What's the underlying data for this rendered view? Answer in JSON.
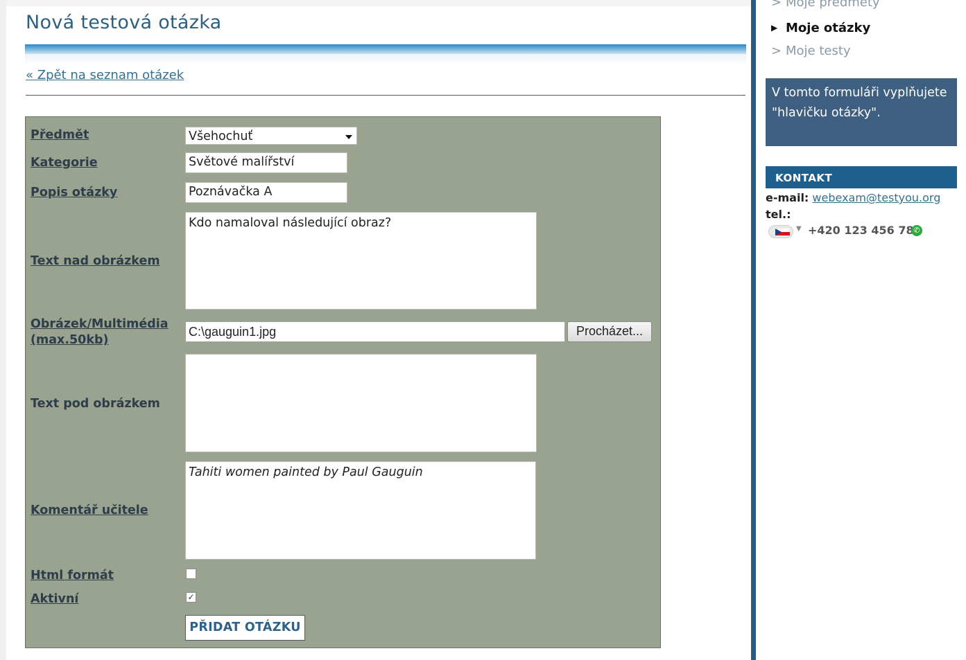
{
  "main": {
    "title": "Nová testová otázka",
    "back_link": "« Zpět na seznam otázek"
  },
  "form": {
    "subject_label": "Předmět",
    "subject_value": "Všehochuť",
    "category_label": "Kategorie",
    "category_value": "Světové malířství",
    "description_label": "Popis otázky",
    "description_value": "Poznávačka A",
    "text_above_label": "Text nad obrázkem",
    "text_above_value": "Kdo namaloval následující obraz?",
    "image_label": "Obrázek/Multimédia",
    "image_limit": "(max.50kb)",
    "image_value": "C:\\gauguin1.jpg",
    "browse_label": "Procházet...",
    "text_below_label": "Text pod obrázkem",
    "text_below_value": "",
    "comment_label": "Komentář učitele",
    "comment_value": "Tahiti women painted by Paul Gauguin",
    "html_label": "Html formát",
    "html_checked": false,
    "active_label": "Aktivní",
    "active_checked": true,
    "submit_label": "PŘIDAT OTÁZKU"
  },
  "sidebar": {
    "nav": [
      {
        "marker": ">",
        "label": "Moje předměty",
        "active": false
      },
      {
        "marker": "▶",
        "label": "Moje otázky",
        "active": true
      },
      {
        "marker": ">",
        "label": "Moje testy",
        "active": false
      }
    ],
    "info_text": "V tomto formuláři vyplňujete \"hlavičku otázky\".",
    "contact_title": "KONTAKT",
    "email_label": "e-mail:",
    "email": "webexam@testyou.org",
    "tel_label": "tel.:",
    "phone": "+420 123 456 789",
    "phone_icon": "call-icon",
    "flag_icon": "czech-flag-icon"
  },
  "colors": {
    "title": "#2d5f7f",
    "form_bg": "#9aa290",
    "sidebar_bar": "#255b86",
    "info_box": "#3e5f80",
    "contact_head": "#1d5f8a"
  }
}
